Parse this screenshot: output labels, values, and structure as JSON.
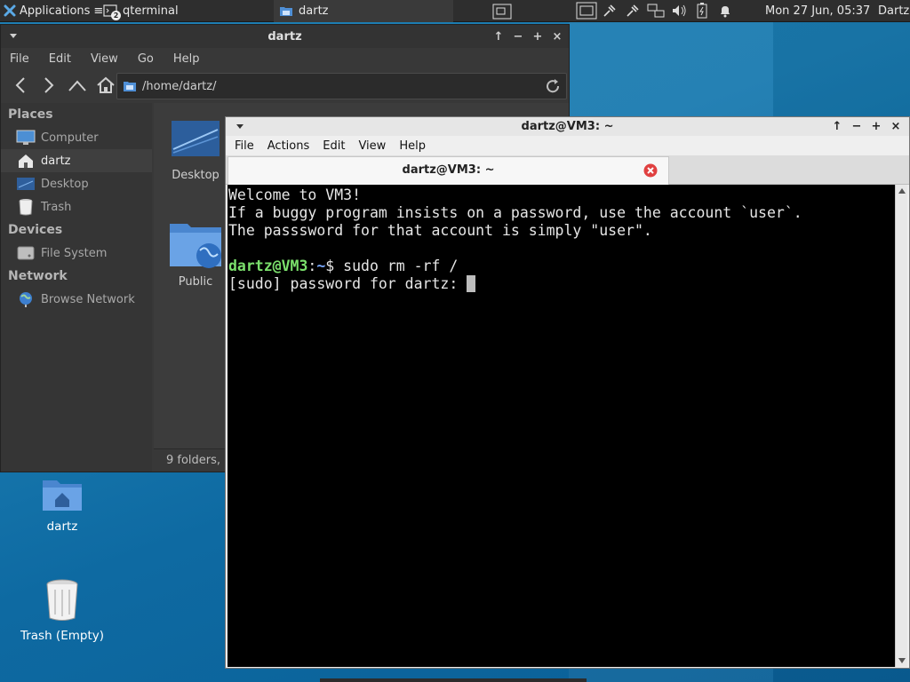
{
  "panel": {
    "applications_label": "Applications",
    "applications_suffix": "≡",
    "tasks": [
      {
        "label": "qterminal",
        "badge": "2"
      },
      {
        "label": "dartz"
      }
    ],
    "clock": "Mon 27 Jun, 05:37",
    "user": "Dartz"
  },
  "file_manager": {
    "title": "dartz",
    "menu": [
      "File",
      "Edit",
      "View",
      "Go",
      "Help"
    ],
    "path": "/home/dartz/",
    "sidebar": {
      "places_title": "Places",
      "places": [
        "Computer",
        "dartz",
        "Desktop",
        "Trash"
      ],
      "devices_title": "Devices",
      "devices": [
        "File System"
      ],
      "network_title": "Network",
      "network": [
        "Browse Network"
      ]
    },
    "items": [
      "Desktop",
      "Public"
    ],
    "status": "9 folders, "
  },
  "terminal": {
    "title": "dartz@VM3: ~",
    "menu": [
      "File",
      "Actions",
      "Edit",
      "View",
      "Help"
    ],
    "tab_title": "dartz@VM3: ~",
    "lines": [
      "Welcome to VM3!",
      "If a buggy program insists on a password, use the account `user`.",
      "The passsword for that account is simply \"user\"."
    ],
    "prompt_user": "dartz@VM3",
    "prompt_sep": ":",
    "prompt_dir": "~",
    "prompt_cmd": "$ sudo rm -rf /",
    "sudo_prompt": "[sudo] password for dartz: "
  },
  "desktop": {
    "icons": [
      "dartz",
      "Trash (Empty)"
    ]
  },
  "colors": {
    "desktop": "#1a7bb0",
    "terminal_bg": "#000000",
    "prompt_user": "#7be06c",
    "prompt_dir": "#79a8ff",
    "close_button": "#e04040"
  }
}
